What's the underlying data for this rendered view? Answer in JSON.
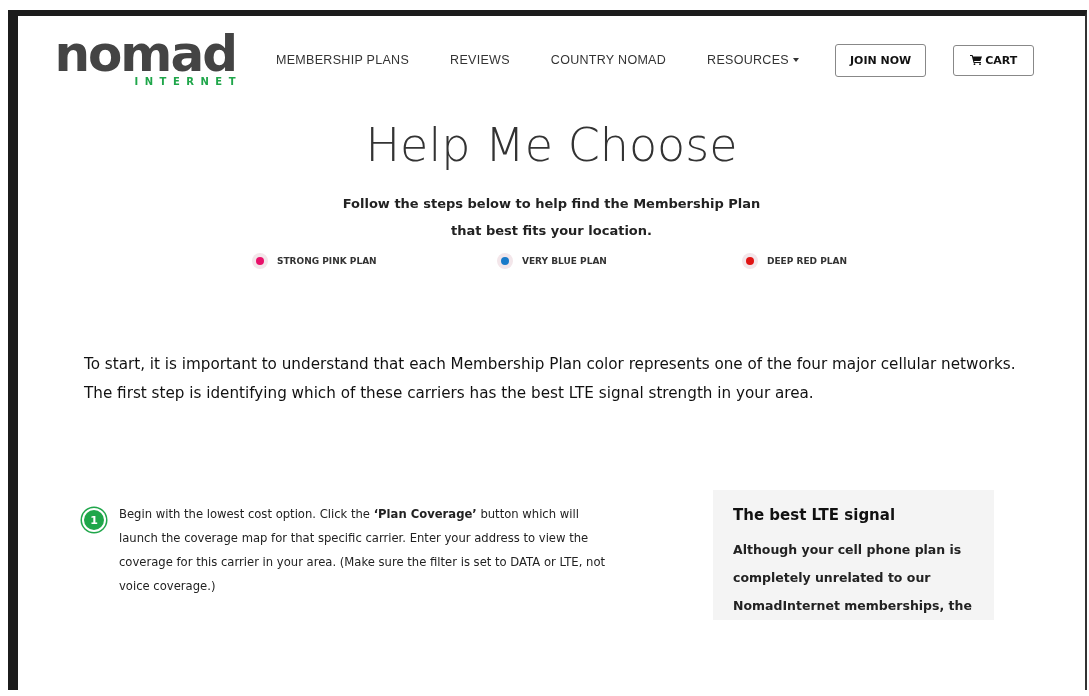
{
  "header": {
    "logo": {
      "wordmark": "nomad",
      "tagline": "INTERNET"
    },
    "nav": [
      {
        "label": "MEMBERSHIP PLANS",
        "kind": "link"
      },
      {
        "label": "REVIEWS",
        "kind": "link"
      },
      {
        "label": "COUNTRY NOMAD",
        "kind": "link"
      },
      {
        "label": "RESOURCES",
        "kind": "dropdown"
      }
    ],
    "buttons": [
      {
        "label": "JOIN NOW",
        "kind": "text"
      },
      {
        "label": "CART",
        "kind": "cart"
      }
    ]
  },
  "hero": {
    "title": "Help Me Choose",
    "subtitle_lines": [
      "Follow the steps below to help find the Membership Plan",
      "that best fits your location."
    ]
  },
  "plans": [
    {
      "label": "STRONG PINK PLAN",
      "color": "#e8116a"
    },
    {
      "label": "VERY BLUE PLAN",
      "color": "#1a7bc9"
    },
    {
      "label": "DEEP RED PLAN",
      "color": "#e01414"
    }
  ],
  "intro": "To start, it is important to understand that each Membership Plan color represents one of the four major cellular networks. The first step is identifying which of these carriers has the best LTE signal strength in your area.",
  "steps": [
    {
      "number": "1",
      "text": "Begin with the lowest cost option. Click the **‘Plan Coverage’** button which will launch the coverage map for that specific carrier. Enter your address to view the coverage for this carrier in your area. (Make sure the filter is set to DATA or LTE, not voice coverage.)"
    }
  ],
  "sidebox": {
    "title": "The best LTE signal",
    "text": "Although your cell phone plan is completely unrelated to our NomadInternet memberships, the"
  }
}
